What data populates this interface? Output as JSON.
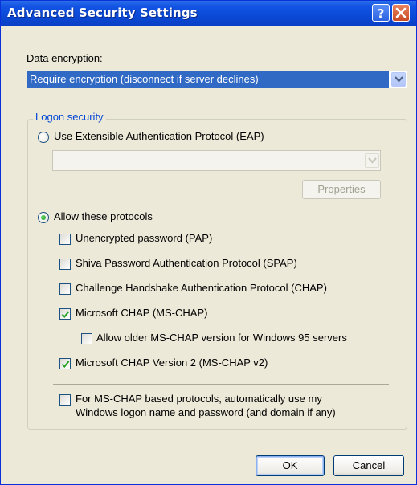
{
  "window": {
    "title": "Advanced Security Settings"
  },
  "encryption": {
    "label": "Data encryption:",
    "selected": "Require encryption (disconnect if server declines)"
  },
  "logon": {
    "group_label": "Logon security",
    "eap_radio_label": "Use Extensible Authentication Protocol (EAP)",
    "eap_selected": false,
    "eap_select_value": "",
    "properties_label": "Properties",
    "allow_radio_label": "Allow these protocols",
    "allow_selected": true,
    "protocols": [
      {
        "label": "Unencrypted password (PAP)",
        "checked": false
      },
      {
        "label": "Shiva Password Authentication Protocol (SPAP)",
        "checked": false
      },
      {
        "label": "Challenge Handshake Authentication Protocol (CHAP)",
        "checked": false
      },
      {
        "label": "Microsoft CHAP (MS-CHAP)",
        "checked": true
      },
      {
        "label": "Allow older MS-CHAP version for Windows 95 servers",
        "checked": false
      },
      {
        "label": "Microsoft CHAP Version 2 (MS-CHAP v2)",
        "checked": true
      }
    ],
    "auto_logon_line1": "For MS-CHAP based protocols, automatically use my",
    "auto_logon_line2": "Windows logon name and password (and domain if any)",
    "auto_logon_checked": false
  },
  "buttons": {
    "ok": "OK",
    "cancel": "Cancel"
  },
  "colors": {
    "titlebar": "#0b4bd8",
    "selection": "#316ac5",
    "group_label": "#0046d5",
    "dialog_bg": "#ece9d8"
  },
  "icons": {
    "help": "help-icon",
    "close": "close-icon",
    "dropdown": "chevron-down-icon",
    "check": "checkmark-icon"
  }
}
